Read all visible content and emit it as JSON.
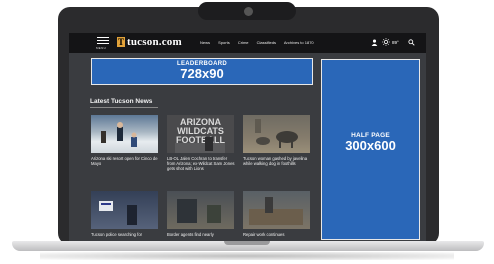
{
  "site": {
    "logo_letter": "T",
    "logo_text": "tucson.com",
    "menu_label": "MENU",
    "nav": [
      "News",
      "Sports",
      "Crime",
      "Classifieds",
      "Archives to 1870"
    ],
    "weather_temp": "89°",
    "icons": [
      "menu-icon",
      "user-icon",
      "sun-icon",
      "search-icon"
    ]
  },
  "ads": {
    "leaderboard_title": "LEADERBOARD",
    "leaderboard_size": "728x90",
    "halfpage_title": "HALF PAGE",
    "halfpage_size": "300x600"
  },
  "news": {
    "section_title": "Latest Tucson News",
    "items": [
      {
        "headline": "Arizona ski resort open for Cinco de Mayo"
      },
      {
        "headline": "LB-OL Jalen Cochran to transfer from Arizona; ex-Wildcat Sam Jones gets shot with Lions"
      },
      {
        "headline": "Tucson woman gashed by javelina while walking dog in foothills"
      },
      {
        "headline": "Tucson police searching for"
      },
      {
        "headline": "Border agents find nearly"
      },
      {
        "headline": "Repair work continues"
      }
    ],
    "image_caption_2": "ARIZONA WILDCATS FOOTBALL"
  },
  "colors": {
    "ad_blue": "#2a67b8",
    "page_bg": "#3a3c40",
    "topbar": "#141416",
    "logo_accent": "#e3a33a"
  }
}
